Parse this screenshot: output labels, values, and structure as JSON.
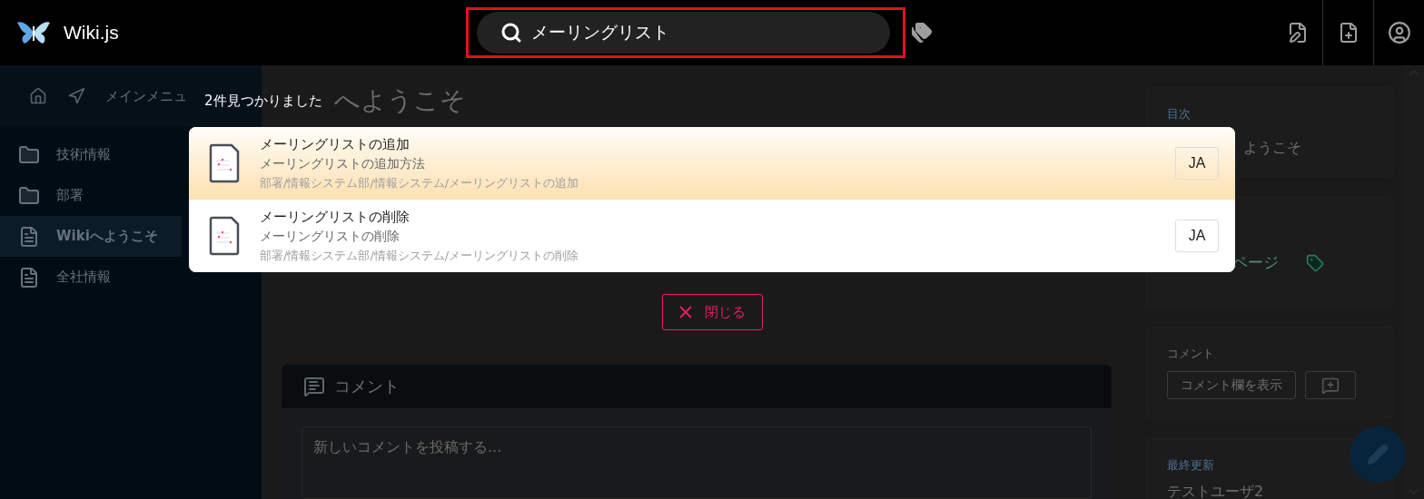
{
  "header": {
    "title": "Wiki.js",
    "search": {
      "value": "メーリングリスト"
    }
  },
  "sidebar": {
    "heading": "メインメニュ",
    "items": [
      {
        "label": "技術情報",
        "kind": "folder",
        "selected": false
      },
      {
        "label": "部署",
        "kind": "folder",
        "selected": false
      },
      {
        "label": "Wikiへようこそ",
        "kind": "page",
        "selected": true
      },
      {
        "label": "全社情報",
        "kind": "page",
        "selected": false
      }
    ]
  },
  "page": {
    "title": "へようこそ",
    "comments": {
      "title": "コメント",
      "placeholder": "新しいコメントを投稿する..."
    }
  },
  "aside": {
    "toc": {
      "heading": "目次",
      "link": "ようこそ"
    },
    "tags": {
      "link": "ページ"
    },
    "comments": {
      "heading": "コメント",
      "button": "コメント欄を表示"
    },
    "updated": {
      "heading": "最終更新",
      "user": "テストユーザ2"
    }
  },
  "search_results": {
    "count": "2件見つかりました",
    "close": "閉じる",
    "results": [
      {
        "title": "メーリングリストの追加",
        "description": "メーリングリストの追加方法",
        "path": "部署/情報システム部/情報システム/メーリングリストの追加",
        "locale": "JA",
        "selected": true
      },
      {
        "title": "メーリングリストの削除",
        "description": "メーリングリストの削除",
        "path": "部署/情報システム部/情報システム/メーリングリストの削除",
        "locale": "JA",
        "selected": false
      }
    ]
  }
}
